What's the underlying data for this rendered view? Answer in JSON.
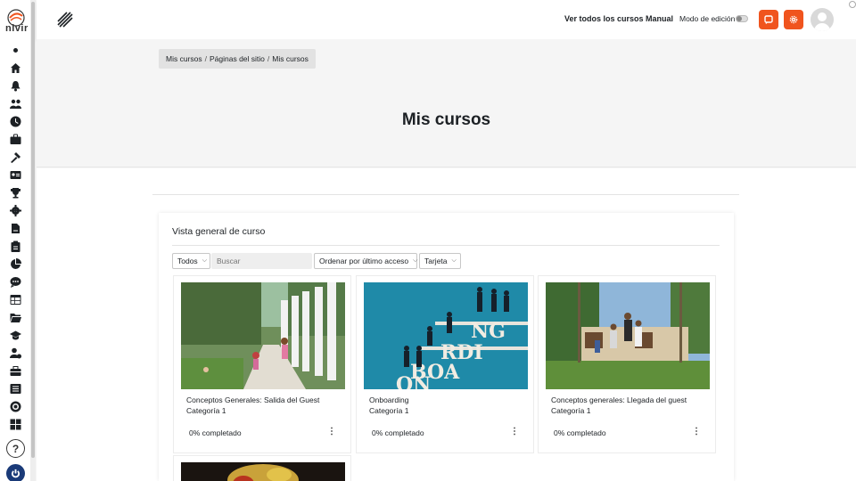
{
  "brand": {
    "logo_text": "nivir"
  },
  "navbar": {
    "all_courses_link": "Ver todos los cursos",
    "manual_link": "Manual",
    "edit_mode_label": "Modo de edición",
    "edit_mode_on": false,
    "accent_color": "#f0541e"
  },
  "sidebar": {
    "icons": [
      "dot-icon",
      "home-icon",
      "bell-icon",
      "users-icon",
      "clock-icon",
      "briefcase-icon",
      "tools-icon",
      "id-card-icon",
      "trophy-icon",
      "gear-icon",
      "file-signature-icon",
      "clipboard-icon",
      "pie-chart-icon",
      "chat-icon",
      "calendar-table-icon",
      "folder-open-icon",
      "graduation-cap-icon",
      "user-info-icon",
      "toolbox-icon",
      "list-icon",
      "circle-target-icon",
      "grid-icon"
    ],
    "help_label": "?",
    "footer_color": "#1a3a78"
  },
  "breadcrumb": [
    "Mis cursos",
    "Páginas del sitio",
    "Mis cursos"
  ],
  "page_title": "Mis cursos",
  "overview": {
    "title": "Vista general de curso",
    "filter_label": "Todos",
    "search_placeholder": "Buscar",
    "sort_label": "Ordenar por último acceso",
    "view_label": "Tarjeta"
  },
  "courses": [
    {
      "title": "Conceptos Generales: Salida del Guest",
      "category": "Categoría 1",
      "progress": "0% completado"
    },
    {
      "title": "Onboarding",
      "category": "Categoría 1",
      "progress": "0% completado"
    },
    {
      "title": "Conceptos generales: Llegada del guest",
      "category": "Categoría 1",
      "progress": "0% completado"
    }
  ],
  "onboarding_image_text": [
    "NG",
    "RDI",
    "BOA",
    "ON"
  ]
}
